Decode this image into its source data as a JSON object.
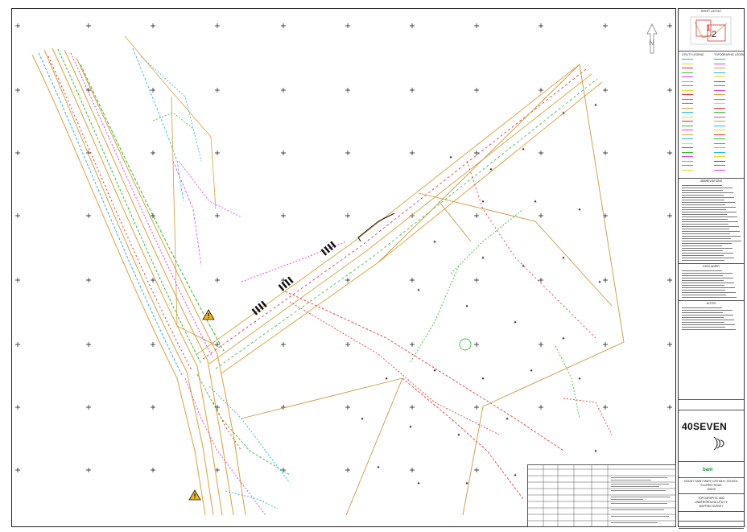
{
  "sheet": {
    "title_block": {
      "sheet_layout_label": "SHEET LAYOUT",
      "layout_sheet_numbers": [
        "1",
        "2"
      ],
      "legend_headings": [
        "UTILITY LEGEND",
        "TOPOGRAPHIC LEGEND"
      ],
      "abbreviations_heading": "ABBREVIATIONS",
      "disclaimer_heading": "DISCLAIMER",
      "notes_heading": "NOTES",
      "company_logo": "40SEVEN",
      "client_logo": "bam",
      "project_lines": [
        "MOUNT SAINT MARY CATHOLIC SCHOOL",
        "ELLERBY ROAD",
        "LEEDS"
      ],
      "drawing_title_lines": [
        "TOPOGRAPHIC AND",
        "UNDERGROUND UTILITY",
        "MAPPING SURVEY"
      ]
    },
    "colors": {
      "kerb": "#d9a23a",
      "boundary": "#c89a40",
      "gas": "#e8d530",
      "electric": "#e03030",
      "water": "#1fb5e6",
      "telecom": "#30c030",
      "drainage": "#e040e0",
      "red_dashed": "#e04040",
      "green_dashed": "#40c040",
      "warning": "#f2b81a"
    },
    "icons": [
      "north-arrow-icon",
      "warning-triangle-icon",
      "grid-cross-icon",
      "crossing-marking-icon"
    ]
  }
}
